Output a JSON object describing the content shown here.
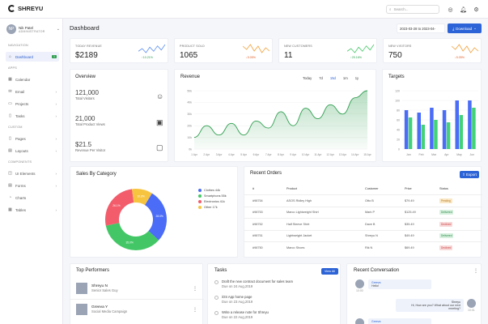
{
  "app": {
    "name": "SHREYU"
  },
  "topbar": {
    "search_placeholder": "Search..."
  },
  "user": {
    "name": "Nik Patel",
    "role": "Administrator",
    "initials": "NP"
  },
  "sidebar": {
    "sections": {
      "navigation": "NAVIGATION",
      "apps": "APPS",
      "custom": "CUSTOM",
      "components": "COMPONENTS"
    },
    "items": [
      {
        "label": "Dashboard",
        "icon": "home-icon",
        "badge": "1"
      },
      {
        "label": "Calendar",
        "icon": "calendar-icon"
      },
      {
        "label": "Email",
        "icon": "inbox-icon"
      },
      {
        "label": "Projects",
        "icon": "briefcase-icon"
      },
      {
        "label": "Tasks",
        "icon": "bookmark-icon"
      },
      {
        "label": "Pages",
        "icon": "file-icon"
      },
      {
        "label": "Layouts",
        "icon": "layout-icon"
      },
      {
        "label": "UI Elements",
        "icon": "package-icon"
      },
      {
        "label": "Forms",
        "icon": "file-text-icon"
      },
      {
        "label": "Charts",
        "icon": "pie-chart-icon"
      },
      {
        "label": "Tables",
        "icon": "grid-icon"
      }
    ]
  },
  "page": {
    "title": "Dashboard",
    "date_range": "2023-03-28 to 2023-04-",
    "download": "Download"
  },
  "kpis": [
    {
      "title": "TODAY REVENUE",
      "value": "$2189",
      "pct": "10.21%",
      "dir": "up"
    },
    {
      "title": "PRODUCT SOLD",
      "value": "1065",
      "pct": "5.05%",
      "dir": "down"
    },
    {
      "title": "NEW CUSTOMERS",
      "value": "11",
      "pct": "25.16%",
      "dir": "up"
    },
    {
      "title": "NEW VISITORS",
      "value": "750",
      "pct": "5.05%",
      "dir": "down"
    }
  ],
  "overview": {
    "title": "Overview",
    "items": [
      {
        "value": "121,000",
        "label": "Total Visitors"
      },
      {
        "value": "21,000",
        "label": "Total Product Views"
      },
      {
        "value": "$21.5",
        "label": "Revenue Per Visitor"
      }
    ]
  },
  "revenue": {
    "title": "Revenue",
    "periods": [
      "Today",
      "7d",
      "15d",
      "1m",
      "1y"
    ],
    "active_period": "15d"
  },
  "targets": {
    "title": "Targets"
  },
  "sales_category": {
    "title": "Sales By Category",
    "legend": [
      "Clothes 44k",
      "Smartphons 55k",
      "Electronics 41k",
      "Other 17k"
    ]
  },
  "orders": {
    "title": "Recent Orders",
    "export": "Export",
    "headers": [
      "#",
      "Product",
      "Customer",
      "Price",
      "Status"
    ],
    "rows": [
      [
        "#98754",
        "ASOS Ridley High",
        "Otto B",
        "$79.49",
        "Pending"
      ],
      [
        "#98753",
        "Marco Lightweight Shirt",
        "Mark P",
        "$125.49",
        "Delivered"
      ],
      [
        "#98752",
        "Half Sleeve Shirt",
        "Dave B",
        "$35.49",
        "Declined"
      ],
      [
        "#98751",
        "Lightweight Jacket",
        "Shreyu N",
        "$49.49",
        "Delivered"
      ],
      [
        "#98750",
        "Marco Shoes",
        "Rik N",
        "$69.49",
        "Declined"
      ]
    ]
  },
  "performers": {
    "title": "Top Performers",
    "people": [
      {
        "name": "Shreyu N",
        "role": "Senior Sales Guy"
      },
      {
        "name": "Greeva Y",
        "role": "Social Media Campaign"
      }
    ]
  },
  "tasks": {
    "title": "Tasks",
    "view_all": "View All",
    "items": [
      {
        "title": "Draft the new contract document for sales team",
        "due": "Due on 24 Aug,2019"
      },
      {
        "title": "iOS App home page",
        "due": "Due on 23 Aug,2019"
      },
      {
        "title": "Write a release note for Shreyu",
        "due": "Due on 22 Aug,2019"
      }
    ]
  },
  "conversation": {
    "title": "Recent Conversation",
    "messages": [
      {
        "sender": "Greeva",
        "text": "Hello!",
        "time": "10:00",
        "side": "left"
      },
      {
        "sender": "Shreyu",
        "text": "Hi, How are you? What about our next meeting?",
        "time": "10:01",
        "side": "right"
      },
      {
        "sender": "Greeva",
        "text": "",
        "time": "",
        "side": "left"
      }
    ]
  },
  "chart_data": [
    {
      "type": "area",
      "title": "Revenue",
      "x": [
        "1 Apr",
        "2 Apr",
        "3 Apr",
        "4 Apr",
        "5 Apr",
        "6 Apr",
        "7 Apr",
        "8 Apr",
        "9 Apr",
        "10 Apr",
        "11 Apr",
        "12 Apr",
        "13 Apr",
        "14 Apr",
        "15 Apr"
      ],
      "series": [
        {
          "values": [
            10,
            20,
            12,
            22,
            12,
            24,
            18,
            32,
            20,
            35,
            26,
            38,
            30,
            44,
            50
          ]
        }
      ],
      "ylim": [
        0,
        50
      ],
      "yticks": [
        "0k",
        "10k",
        "20k",
        "30k",
        "40k",
        "50k"
      ],
      "color": "#2e9e4f"
    },
    {
      "type": "bar",
      "title": "Targets",
      "categories": [
        "Jan",
        "Feb",
        "Mar",
        "Apr",
        "May",
        "Jun"
      ],
      "series": [
        {
          "values": [
            80,
            75,
            85,
            80,
            100,
            100
          ],
          "color": "#4a6cf7"
        },
        {
          "values": [
            65,
            50,
            60,
            55,
            70,
            85
          ],
          "color": "#43d17a"
        }
      ],
      "ylim": [
        0,
        120
      ],
      "yticks": [
        "0",
        "20",
        "40",
        "60",
        "80",
        "100",
        "120"
      ]
    },
    {
      "type": "pie",
      "title": "Sales By Category",
      "categories": [
        "Clothes",
        "Smartphons",
        "Electronics",
        "Other"
      ],
      "values": [
        44,
        55,
        41,
        17
      ],
      "labels": [
        "28.0%",
        "35.0%",
        "26.1%",
        "10.8%"
      ],
      "colors": [
        "#4a6cf7",
        "#43c766",
        "#f25c6b",
        "#f7c43f"
      ]
    },
    {
      "type": "line",
      "title": "kpi sparklines",
      "series": [
        {
          "values": [
            3,
            5,
            2,
            6,
            3,
            7,
            4,
            8
          ],
          "color": "#5b8def"
        },
        {
          "values": [
            6,
            4,
            7,
            3,
            6,
            2,
            5,
            3
          ],
          "color": "#f0a23e"
        },
        {
          "values": [
            3,
            5,
            2,
            6,
            3,
            7,
            4,
            8
          ],
          "color": "#43c766"
        },
        {
          "values": [
            6,
            4,
            7,
            3,
            6,
            2,
            5,
            3
          ],
          "color": "#f0a23e"
        }
      ]
    }
  ]
}
